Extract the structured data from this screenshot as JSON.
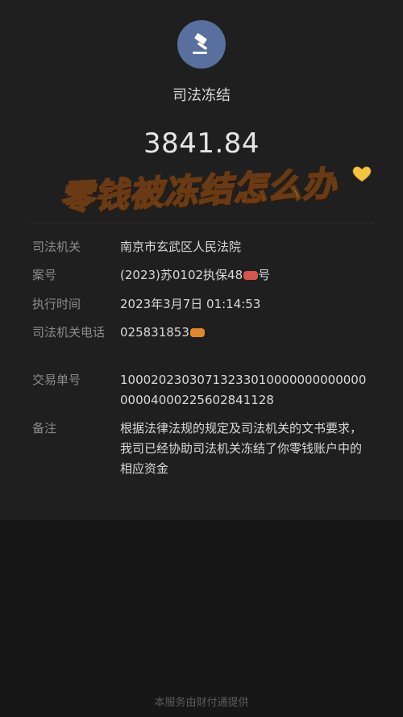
{
  "header": {
    "title": "司法冻结",
    "amount": "3841.84",
    "icon": "gavel-icon",
    "avatar_color": "#59709f"
  },
  "overlay": {
    "text": "零钱被冻结怎么办",
    "color": "#ffd84a",
    "heart_color": "#f5c542"
  },
  "details": [
    {
      "label": "司法机关",
      "value": "南京市玄武区人民法院"
    },
    {
      "label": "案号",
      "value": "(2023)苏0102执保48"
    },
    {
      "label": "案号后缀",
      "value": "号"
    },
    {
      "label": "执行时间",
      "value": "2023年3月7日 01:14:53"
    },
    {
      "label": "司法机关电话",
      "value": "025831853"
    },
    {
      "label": "交易单号",
      "value": "1000202303071323301000000000000000004000225602841128"
    },
    {
      "label": "备注",
      "value": "根据法律法规的规定及司法机关的文书要求，我司已经协助司法机关冻结了你零钱账户中的相应资金"
    }
  ],
  "footer": {
    "text": "本服务由财付通提供"
  },
  "colors": {
    "background": "#1f1f1f",
    "label": "#8b8b8b",
    "value": "#d9d9d9",
    "sticker_red": "#d9534f",
    "sticker_orange": "#e0892c"
  }
}
